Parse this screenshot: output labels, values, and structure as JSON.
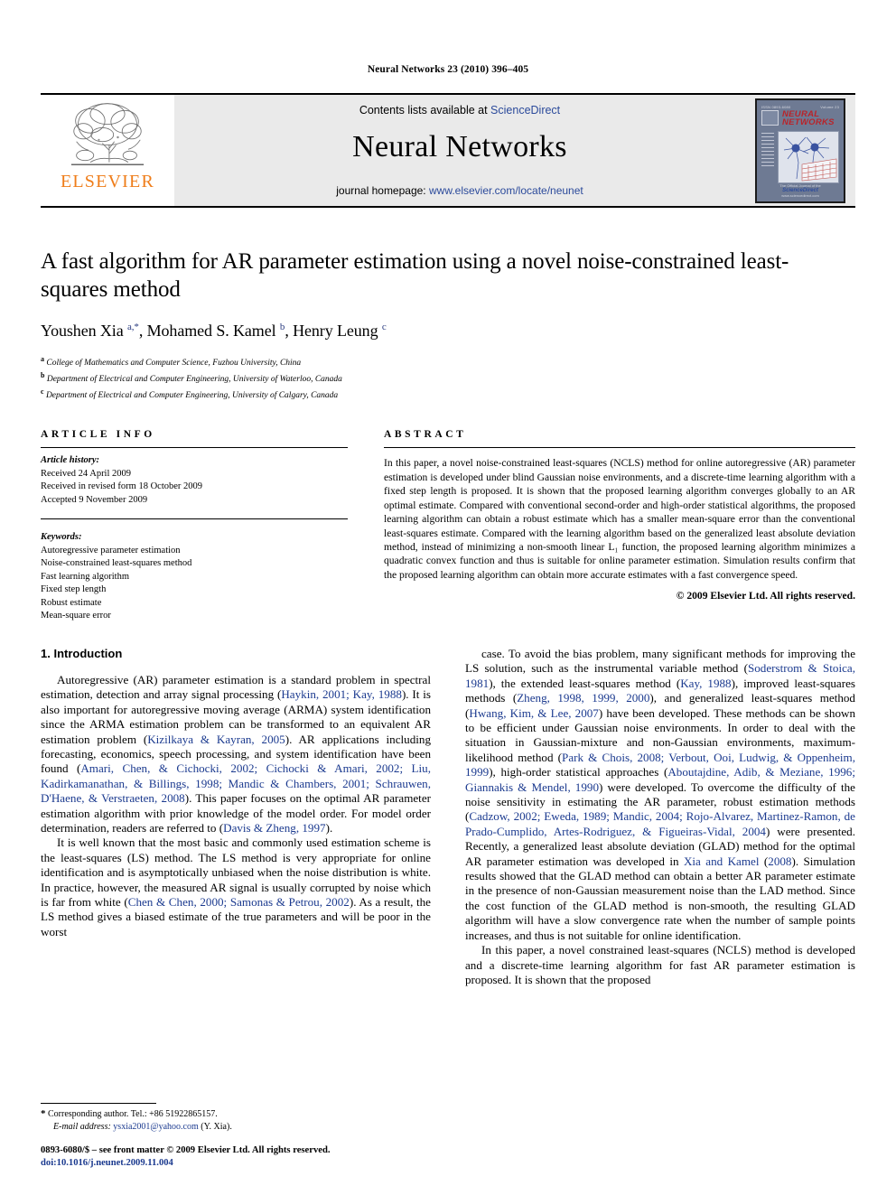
{
  "running_head": "Neural Networks 23 (2010) 396–405",
  "masthead": {
    "publisher_logo_name": "elsevier-tree-logo",
    "publisher_wordmark": "ELSEVIER",
    "contents_prefix": "Contents lists available at ",
    "contents_link": "ScienceDirect",
    "journal_name": "Neural Networks",
    "homepage_prefix": "journal homepage: ",
    "homepage_url": "www.elsevier.com/locate/neunet",
    "cover": {
      "issn_left": "ISSN 0893-6080",
      "issn_right": "Volume 23",
      "title_line1": "NEURAL",
      "title_line2": "NETWORKS",
      "foot_text": "The Official Journal of the",
      "foot_brand": "ScienceDirect",
      "foot_url": "www.sciencedirect.com"
    }
  },
  "article": {
    "title": "A fast algorithm for AR parameter estimation using a novel noise-constrained least-squares method",
    "authors_html": "Youshen Xia <sup>a,*</sup>, Mohamed S. Kamel <sup>b</sup>, Henry Leung <sup>c</sup>",
    "affiliations": [
      {
        "marker": "a",
        "text": "College of Mathematics and Computer Science, Fuzhou University, China"
      },
      {
        "marker": "b",
        "text": "Department of Electrical and Computer Engineering, University of Waterloo, Canada"
      },
      {
        "marker": "c",
        "text": "Department of Electrical and Computer Engineering, University of Calgary, Canada"
      }
    ]
  },
  "article_info": {
    "heading": "ARTICLE INFO",
    "history_label": "Article history:",
    "history": [
      "Received 24 April 2009",
      "Received in revised form 18 October 2009",
      "Accepted 9 November 2009"
    ],
    "keywords_label": "Keywords:",
    "keywords": [
      "Autoregressive parameter estimation",
      "Noise-constrained least-squares method",
      "Fast learning algorithm",
      "Fixed step length",
      "Robust estimate",
      "Mean-square error"
    ]
  },
  "abstract": {
    "heading": "ABSTRACT",
    "text": "In this paper, a novel noise-constrained least-squares (NCLS) method for online autoregressive (AR) parameter estimation is developed under blind Gaussian noise environments, and a discrete-time learning algorithm with a fixed step length is proposed. It is shown that the proposed learning algorithm converges globally to an AR optimal estimate. Compared with conventional second-order and high-order statistical algorithms, the proposed learning algorithm can obtain a robust estimate which has a smaller mean-square error than the conventional least-squares estimate. Compared with the learning algorithm based on the generalized least absolute deviation method, instead of minimizing a non-smooth linear L₁ function, the proposed learning algorithm minimizes a quadratic convex function and thus is suitable for online parameter estimation. Simulation results confirm that the proposed learning algorithm can obtain more accurate estimates with a fast convergence speed.",
    "copyright": "© 2009 Elsevier Ltd. All rights reserved."
  },
  "sections": {
    "intro_heading": "1. Introduction",
    "left_paragraphs": [
      "Autoregressive (AR) parameter estimation is a standard problem in spectral estimation, detection and array signal processing (Haykin, 2001; Kay, 1988). It is also important for autoregressive moving average (ARMA) system identification since the ARMA estimation problem can be transformed to an equivalent AR estimation problem (Kizilkaya & Kayran, 2005). AR applications including forecasting, economics, speech processing, and system identification have been found (Amari, Chen, & Cichocki, 2002; Cichocki & Amari, 2002; Liu, Kadirkamanathan, & Billings, 1998; Mandic & Chambers, 2001; Schrauwen, D'Haene, & Verstraeten, 2008). This paper focuses on the optimal AR parameter estimation algorithm with prior knowledge of the model order. For model order determination, readers are referred to (Davis & Zheng, 1997).",
      "It is well known that the most basic and commonly used estimation scheme is the least-squares (LS) method. The LS method is very appropriate for online identification and is asymptotically unbiased when the noise distribution is white. In practice, however, the measured AR signal is usually corrupted by noise which is far from white (Chen & Chen, 2000; Samonas & Petrou, 2002). As a result, the LS method gives a biased estimate of the true parameters and will be poor in the worst"
    ],
    "right_paragraphs": [
      "case. To avoid the bias problem, many significant methods for improving the LS solution, such as the instrumental variable method (Soderstrom & Stoica, 1981), the extended least-squares method (Kay, 1988), improved least-squares methods (Zheng, 1998, 1999, 2000), and generalized least-squares method (Hwang, Kim, & Lee, 2007) have been developed. These methods can be shown to be efficient under Gaussian noise environments. In order to deal with the situation in Gaussian-mixture and non-Gaussian environments, maximum-likelihood method (Park & Chois, 2008; Verbout, Ooi, Ludwig, & Oppenheim, 1999), high-order statistical approaches (Aboutajdine, Adib, & Meziane, 1996; Giannakis & Mendel, 1990) were developed. To overcome the difficulty of the noise sensitivity in estimating the AR parameter, robust estimation methods (Cadzow, 2002; Eweda, 1989; Mandic, 2004; Rojo-Alvarez, Martinez-Ramon, de Prado-Cumplido, Artes-Rodriguez, & Figueiras-Vidal, 2004) were presented. Recently, a generalized least absolute deviation (GLAD) method for the optimal AR parameter estimation was developed in Xia and Kamel (2008). Simulation results showed that the GLAD method can obtain a better AR parameter estimate in the presence of non-Gaussian measurement noise than the LAD method. Since the cost function of the GLAD method is non-smooth, the resulting GLAD algorithm will have a slow convergence rate when the number of sample points increases, and thus is not suitable for online identification.",
      "In this paper, a novel constrained least-squares (NCLS) method is developed and a discrete-time learning algorithm for fast AR parameter estimation is proposed. It is shown that the proposed"
    ]
  },
  "footnote": {
    "star": "*",
    "corresponding": "Corresponding author. Tel.: +86 51922865157.",
    "email_label": "E-mail address:",
    "email": "ysxia2001@yahoo.com",
    "email_suffix": "(Y. Xia)."
  },
  "imprint": {
    "line1": "0893-6080/$ – see front matter © 2009 Elsevier Ltd. All rights reserved.",
    "doi": "doi:10.1016/j.neunet.2009.11.004"
  },
  "colors": {
    "link": "#2b4a9b",
    "citation": "#1b3a8f",
    "elsevier_orange": "#ef7d1a",
    "masthead_bg": "#eaeaea",
    "cover_red": "#b9242a"
  }
}
